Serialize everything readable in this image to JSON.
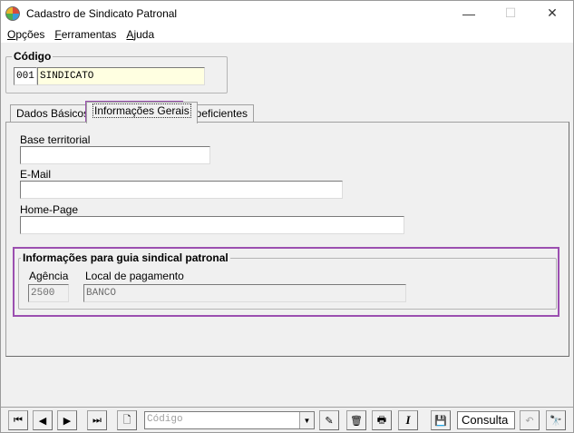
{
  "window": {
    "title": "Cadastro de Sindicato Patronal",
    "minimize": "—",
    "maximize": "☐",
    "close": "✕"
  },
  "menu": {
    "items": [
      {
        "first": "O",
        "rest": "pções"
      },
      {
        "first": "F",
        "rest": "erramentas"
      },
      {
        "first": "A",
        "rest": "juda"
      }
    ]
  },
  "codigo": {
    "legend": "Código",
    "code": "001",
    "name": "SINDICATO"
  },
  "tabs": [
    {
      "label": "Dados Básicos"
    },
    {
      "label": "Informações Gerais"
    },
    {
      "label": "Coeficientes"
    }
  ],
  "info": {
    "base_label": "Base territorial",
    "base_value": "",
    "email_label": "E-Mail",
    "email_value": "",
    "home_label": "Home-Page",
    "home_value": "",
    "guia_legend": "Informações para guia sindical patronal",
    "agencia_label": "Agência",
    "agencia_value": "2500",
    "local_label": "Local de pagamento",
    "local_value": "BANCO"
  },
  "toolbar": {
    "first": "⏮",
    "prev": "◀",
    "next": "▶",
    "last": "⏭",
    "new": "🗋",
    "combo_placeholder": "Código",
    "combo_arrow": "▼",
    "edit": "✎",
    "delete": "🗑",
    "print": "🖶",
    "italic": "I",
    "save": "💾",
    "mode": "Consulta",
    "undo": "↶",
    "find": "🔭"
  },
  "colors": {
    "highlight": "#9b4fb0",
    "code_field_bg": "#ffffe1"
  }
}
